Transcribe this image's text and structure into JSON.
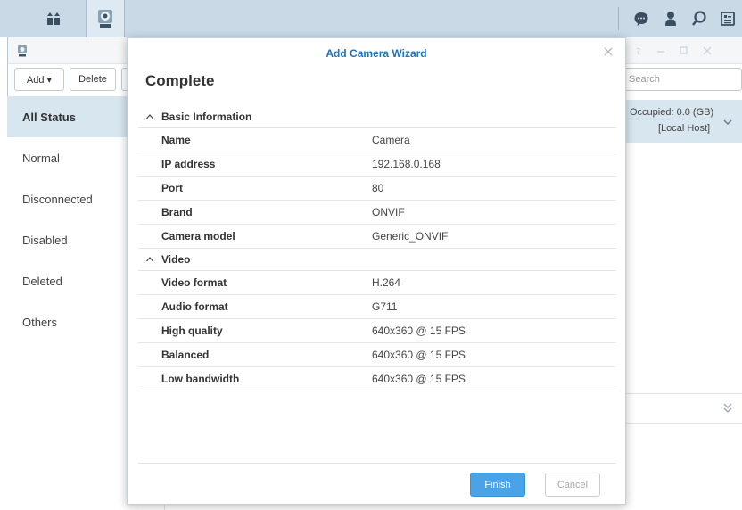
{
  "taskbar": {
    "icons": [
      "main-menu-icon",
      "surveillance-app-icon",
      "chat-icon",
      "user-icon",
      "search-icon",
      "widgets-icon"
    ]
  },
  "app": {
    "toolbar": {
      "add_label": "Add ▾",
      "delete_label": "Delete",
      "search_placeholder": "Search"
    },
    "sidebar": {
      "items": [
        {
          "label": "All Status"
        },
        {
          "label": "Normal"
        },
        {
          "label": "Disconnected"
        },
        {
          "label": "Disabled"
        },
        {
          "label": "Deleted"
        },
        {
          "label": "Others"
        }
      ]
    },
    "right_panel": {
      "occupied": "Occupied: 0.0 (GB)",
      "host": "[Local Host]"
    }
  },
  "modal": {
    "title": "Add Camera Wizard",
    "heading": "Complete",
    "sections": [
      {
        "title": "Basic Information",
        "rows": [
          {
            "key": "Name",
            "value": "Camera"
          },
          {
            "key": "IP address",
            "value": "192.168.0.168"
          },
          {
            "key": "Port",
            "value": "80"
          },
          {
            "key": "Brand",
            "value": "ONVIF"
          },
          {
            "key": "Camera model",
            "value": "Generic_ONVIF"
          }
        ]
      },
      {
        "title": "Video",
        "rows": [
          {
            "key": "Video format",
            "value": "H.264"
          },
          {
            "key": "Audio format",
            "value": "G711"
          },
          {
            "key": "High quality",
            "value": "640x360 @ 15 FPS"
          },
          {
            "key": "Balanced",
            "value": "640x360 @ 15 FPS"
          },
          {
            "key": "Low bandwidth",
            "value": "640x360 @ 15 FPS"
          }
        ]
      }
    ],
    "finish_label": "Finish",
    "cancel_label": "Cancel"
  },
  "colors": {
    "accent": "#1f73b7",
    "primary_button": "#4aa3e6",
    "selected_bg": "#d8e6f0",
    "taskbar_bg": "#c9d9e6"
  }
}
